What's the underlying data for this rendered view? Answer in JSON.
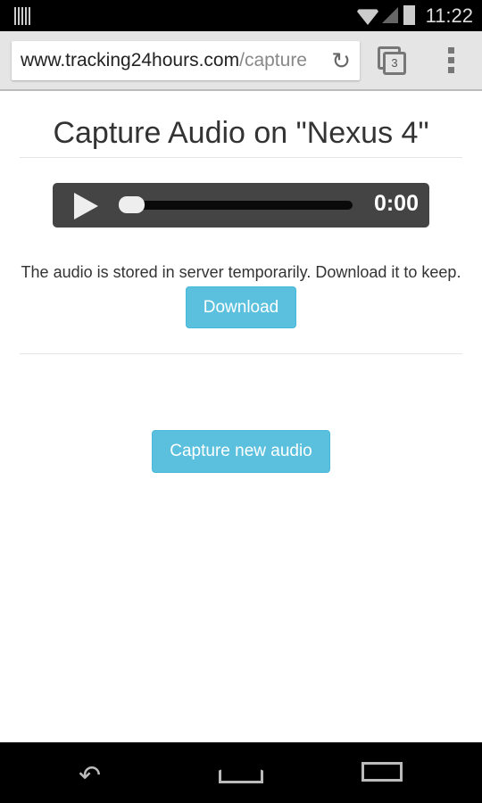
{
  "status": {
    "time": "11:22"
  },
  "browser": {
    "url_host": "www.tracking24hours.com",
    "url_path": "/capture",
    "tab_count": "3"
  },
  "page": {
    "title": "Capture Audio on \"Nexus 4\"",
    "player_time": "0:00",
    "player_progress": 0,
    "message": "The audio is stored in server temporarily. Download it to keep.",
    "download_label": "Download",
    "capture_label": "Capture new audio"
  },
  "colors": {
    "button": "#5bc0de",
    "player": "#444444"
  }
}
